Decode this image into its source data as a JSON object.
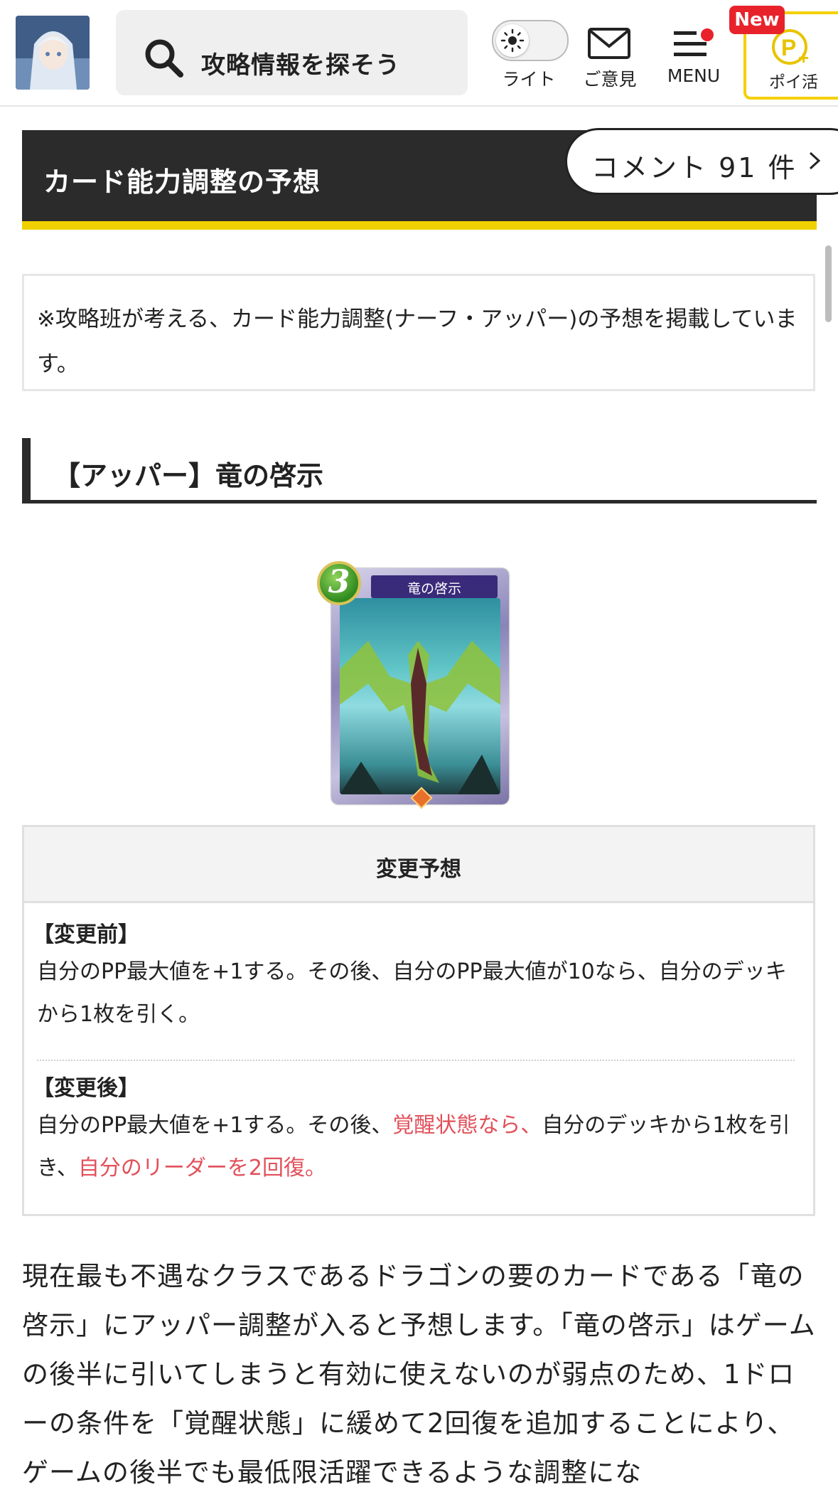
{
  "header": {
    "search_placeholder": "攻略情報を探そう",
    "light_label": "ライト",
    "feedback_label": "ご意見",
    "menu_label": "MENU",
    "poi_label": "ポイ活",
    "new_badge": "New"
  },
  "article": {
    "title": "カード能力調整の予想",
    "comment_button": "コメント 91 件",
    "notice": "※攻略班が考える、カード能力調整(ナーフ・アッパー)の予想を掲載しています。",
    "section_heading": "【アッパー】竜の啓示",
    "card": {
      "name": "竜の啓示",
      "cost": "3"
    },
    "table": {
      "header": "変更予想",
      "before_label": "【変更前】",
      "before_text": "自分のPP最大値を+1する。その後、自分のPP最大値が10なら、自分のデッキから1枚を引く。",
      "after_label": "【変更後】",
      "after_text_1": "自分のPP最大値を+1する。その後、",
      "after_text_2": "覚醒状態なら、",
      "after_text_3": "自分のデッキから1枚を引き、",
      "after_text_4": "自分のリーダーを2回復。"
    },
    "paragraph": "現在最も不遇なクラスであるドラゴンの要のカードである「竜の啓示」にアッパー調整が入ると予想します。「竜の啓示」はゲームの後半に引いてしまうと有効に使えないのが弱点のため、1ドローの条件を「覚醒状態」に緩めて2回復を追加することにより、ゲームの後半でも最低限活躍できるような調整にな"
  },
  "colors": {
    "accent_yellow": "#f0d000",
    "dark_bar": "#2b2b2b",
    "highlight_red": "#e2505a",
    "new_badge_red": "#e8222b"
  }
}
